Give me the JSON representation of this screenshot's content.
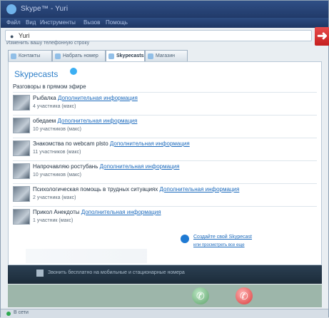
{
  "window": {
    "title": "Skype™ - Yuri",
    "menu": [
      "Файл",
      "Вид",
      "Инструменты",
      "Вызов",
      "Помощь"
    ]
  },
  "search": {
    "value": "Yuri"
  },
  "subbar": {
    "text": "Изменить вашу телефонную строку"
  },
  "tabs": [
    {
      "label": "Контакты"
    },
    {
      "label": "Набрать номер"
    },
    {
      "label": "Skypecasts"
    },
    {
      "label": "Магазин"
    }
  ],
  "content": {
    "brand": "Skypecasts",
    "section_title": "Разговоры в прямом эфире",
    "items": [
      {
        "title": "Рыбалка",
        "link": "Дополнительная информация",
        "sub": "4 участника (макс)"
      },
      {
        "title": "обедаем",
        "link": "Дополнительная информация",
        "sub": "10 участников (макс)"
      },
      {
        "title": "Знакомства по webcam plsto",
        "link": "Дополнительная информация",
        "sub": "11 участников (макс)"
      },
      {
        "title": "Напрочавляю ростубань",
        "link": "Дополнительная информация",
        "sub": "10 участников (макс)"
      },
      {
        "title": "Психологическая помощь в трудных ситуациях",
        "link": "Дополнительная информация",
        "sub": "2 участника (макс)"
      },
      {
        "title": "Прикол Анекдоты",
        "link": "Дополнительная информация",
        "sub": "1 участник (макс)"
      }
    ],
    "promo": {
      "line1": "Создайте свой Skypecast",
      "line2": "или просмотреть все еще"
    }
  },
  "footer": {
    "text": "Звонить бесплатно на мобильные и стационарные номера"
  },
  "status": {
    "text": "В сети"
  },
  "colors": {
    "accent": "#2f7fc8",
    "link": "#1d6bbd",
    "titlebar": "#2f4f86",
    "exit": "#c51f1f",
    "call_green": "#5da26a",
    "call_red": "#d93c3c"
  },
  "icons": {
    "exit": "arrow-right-icon",
    "call": "phone-icon",
    "hangup": "phone-hangup-icon"
  }
}
